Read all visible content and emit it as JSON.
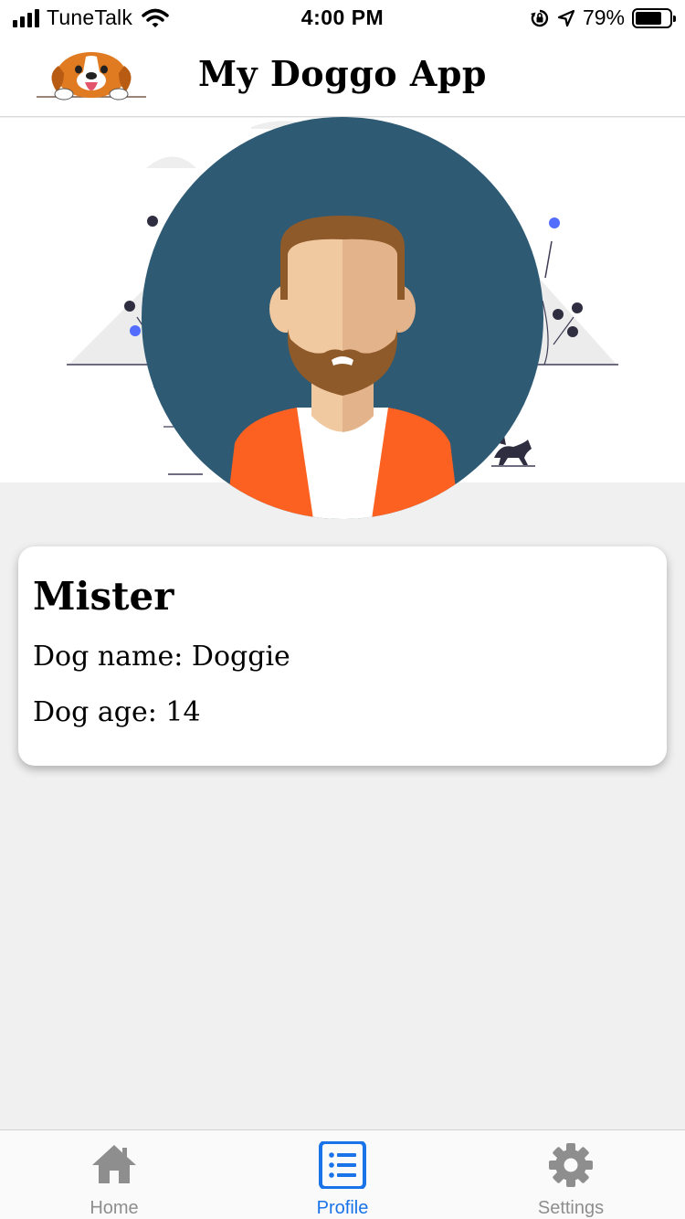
{
  "status_bar": {
    "carrier": "TuneTalk",
    "time": "4:00 PM",
    "battery_percent": "79%",
    "battery_level": 0.79,
    "signal_bars": 4,
    "icons": [
      "signal-icon",
      "wifi-icon",
      "orientation-lock-icon",
      "location-arrow-icon",
      "battery-icon"
    ]
  },
  "header": {
    "title": "My Doggo App",
    "logo_icon": "beagle-logo-icon"
  },
  "profile": {
    "owner_name": "Mister",
    "dog_name_label": "Dog name:",
    "dog_name": "Doggie",
    "dog_age_label": "Dog age:",
    "dog_age": "14"
  },
  "tabs": [
    {
      "label": "Home",
      "icon": "home-icon",
      "active": false
    },
    {
      "label": "Profile",
      "icon": "list-icon",
      "active": true
    },
    {
      "label": "Settings",
      "icon": "gear-icon",
      "active": false
    }
  ],
  "colors": {
    "active_tab": "#1a73e8",
    "inactive_tab": "#8e8e8e",
    "avatar_bg": "#2e5a74",
    "jacket": "#fd6121",
    "hair": "#8f5a2a",
    "skin": "#f1c9a0",
    "page_bg": "#f0f0f0"
  }
}
